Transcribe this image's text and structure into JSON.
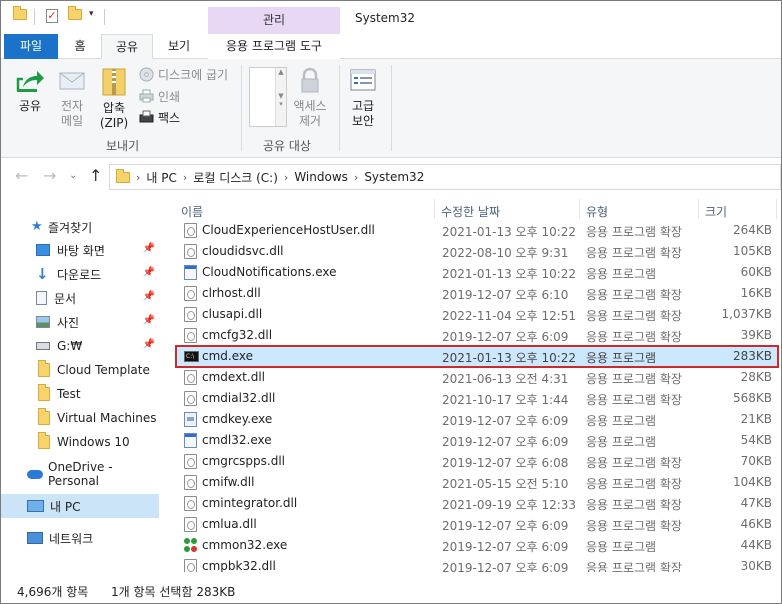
{
  "window": {
    "title": "System32",
    "context_tab": "관리"
  },
  "tabs": {
    "file": "파일",
    "home": "홈",
    "share": "공유",
    "view": "보기",
    "app_tools": "응용 프로그램 도구"
  },
  "ribbon": {
    "share_label": "공유",
    "email_line1": "전자",
    "email_line2": "메일",
    "zip_line1": "압축",
    "zip_line2": "(ZIP)",
    "burn": "디스크에 굽기",
    "print": "인쇄",
    "fax": "팩스",
    "send_group": "보내기",
    "access_line1": "액세스",
    "access_line2": "제거",
    "share_with_group": "공유 대상",
    "security_line1": "고급",
    "security_line2": "보안"
  },
  "address": {
    "crumbs": [
      "내 PC",
      "로컬 디스크 (C:)",
      "Windows",
      "System32"
    ]
  },
  "sidebar": {
    "quick_access": "즐겨찾기",
    "items": [
      {
        "label": "바탕 화면",
        "pinned": true
      },
      {
        "label": "다운로드",
        "pinned": true
      },
      {
        "label": "문서",
        "pinned": true
      },
      {
        "label": "사진",
        "pinned": true
      },
      {
        "label": "G:₩",
        "pinned": true
      },
      {
        "label": "Cloud Template",
        "pinned": false
      },
      {
        "label": "Test",
        "pinned": false
      },
      {
        "label": "Virtual Machines",
        "pinned": false
      },
      {
        "label": "Windows 10",
        "pinned": false
      }
    ],
    "onedrive": "OneDrive - Personal",
    "this_pc": "내 PC",
    "network": "네트워크"
  },
  "columns": {
    "name": "이름",
    "modified": "수정한 날짜",
    "type": "유형",
    "size": "크기"
  },
  "files": [
    {
      "name": "CloudExperienceHostUser.dll",
      "date": "2021-01-13 오후 10:22",
      "type": "응용 프로그램 확장",
      "size": "264KB",
      "icon": "dll-icon"
    },
    {
      "name": "cloudidsvc.dll",
      "date": "2022-08-10 오후 9:31",
      "type": "응용 프로그램 확장",
      "size": "105KB",
      "icon": "dll-icon"
    },
    {
      "name": "CloudNotifications.exe",
      "date": "2021-01-13 오후 10:22",
      "type": "응용 프로그램",
      "size": "60KB",
      "icon": "exe-icon"
    },
    {
      "name": "clrhost.dll",
      "date": "2019-12-07 오후 6:10",
      "type": "응용 프로그램 확장",
      "size": "16KB",
      "icon": "dll-icon"
    },
    {
      "name": "clusapi.dll",
      "date": "2022-11-04 오후 12:51",
      "type": "응용 프로그램 확장",
      "size": "1,037KB",
      "icon": "dll-icon"
    },
    {
      "name": "cmcfg32.dll",
      "date": "2019-12-07 오후 6:09",
      "type": "응용 프로그램 확장",
      "size": "39KB",
      "icon": "dll-icon"
    },
    {
      "name": "cmd.exe",
      "date": "2021-01-13 오후 10:22",
      "type": "응용 프로그램",
      "size": "283KB",
      "icon": "cmd-icon",
      "selected": true
    },
    {
      "name": "cmdext.dll",
      "date": "2021-06-13 오전 4:31",
      "type": "응용 프로그램 확장",
      "size": "28KB",
      "icon": "dll-icon"
    },
    {
      "name": "cmdial32.dll",
      "date": "2021-10-17 오후 1:44",
      "type": "응용 프로그램 확장",
      "size": "568KB",
      "icon": "dll-icon"
    },
    {
      "name": "cmdkey.exe",
      "date": "2019-12-07 오후 6:09",
      "type": "응용 프로그램",
      "size": "21KB",
      "icon": "key-icon"
    },
    {
      "name": "cmdl32.exe",
      "date": "2019-12-07 오후 6:09",
      "type": "응용 프로그램",
      "size": "54KB",
      "icon": "cmdl-icon"
    },
    {
      "name": "cmgrcspps.dll",
      "date": "2019-12-07 오후 6:08",
      "type": "응용 프로그램 확장",
      "size": "70KB",
      "icon": "dll-icon"
    },
    {
      "name": "cmifw.dll",
      "date": "2021-05-15 오전 5:10",
      "type": "응용 프로그램 확장",
      "size": "104KB",
      "icon": "dll-icon"
    },
    {
      "name": "cmintegrator.dll",
      "date": "2021-09-19 오후 12:33",
      "type": "응용 프로그램 확장",
      "size": "47KB",
      "icon": "dll-icon"
    },
    {
      "name": "cmlua.dll",
      "date": "2019-12-07 오후 6:09",
      "type": "응용 프로그램 확장",
      "size": "46KB",
      "icon": "dll-icon"
    },
    {
      "name": "cmmon32.exe",
      "date": "2019-12-07 오후 6:09",
      "type": "응용 프로그램",
      "size": "44KB",
      "icon": "cmmon-icon"
    },
    {
      "name": "cmpbk32.dll",
      "date": "2019-12-07 오후 6:09",
      "type": "응용 프로그램 확장",
      "size": "30KB",
      "icon": "dll-icon"
    }
  ],
  "status": {
    "count": "4,696개 항목",
    "selection": "1개 항목 선택함 283KB"
  },
  "colors": {
    "accent": "#1a73c8",
    "selection": "#cce8ff",
    "highlight_border": "#cc2a2a",
    "context_tab": "#e8d7f5"
  }
}
